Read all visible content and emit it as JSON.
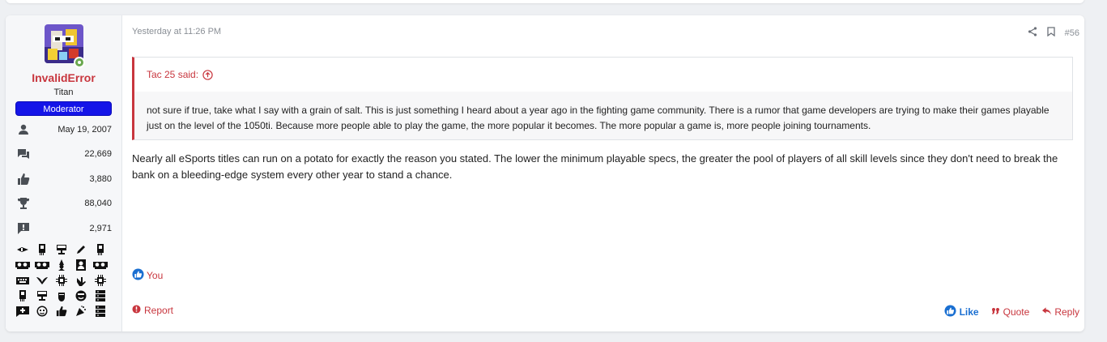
{
  "user": {
    "name": "InvalidError",
    "title": "Titan",
    "banner": "Moderator",
    "stats": [
      {
        "icon": "person-icon",
        "value": "May 19, 2007"
      },
      {
        "icon": "messages-icon",
        "value": "22,669"
      },
      {
        "icon": "thumbs-up-icon",
        "value": "3,880"
      },
      {
        "icon": "trophy-icon",
        "value": "88,040"
      },
      {
        "icon": "alert-message-icon",
        "value": "2,971"
      }
    ],
    "trophy_icons": [
      "sword-icon",
      "memory-card-icon",
      "monitor-icon",
      "pencil-icon",
      "memory-card-icon",
      "graphics-card-icon",
      "graphics-card-icon",
      "wizard-icon",
      "portrait-icon",
      "graphics-card-icon",
      "keyboard-icon",
      "wings-icon",
      "cpu-icon",
      "hand-icon",
      "cpu-icon",
      "memory-card-icon",
      "monitor-icon",
      "fist-icon",
      "smiley-icon",
      "server-icon",
      "comment-plus-icon",
      "smiley-icon",
      "thumbs-up-icon",
      "party-icon",
      "server-icon"
    ]
  },
  "post": {
    "date": "Yesterday at 11:26 PM",
    "number": "#56",
    "quote": {
      "author": "Tac 25 said:",
      "text": "not sure if true, take what I say with a grain of salt. This is just something I heard about a year ago in the fighting game community. There is a rumor that game developers are trying to make their games playable just on the level of the 1050ti. Because more people able to play the game, the more popular it becomes. The more popular a game is, more people joining tournaments."
    },
    "message": "Nearly all eSports titles can run on a potato for exactly the reason you stated. The lower the minimum playable specs, the greater the pool of players of all skill levels since they don't need to break the bank on a bleeding-edge system every other year to stand a chance.",
    "reactions": "You"
  },
  "footer": {
    "report": "Report",
    "like": "Like",
    "quote": "Quote",
    "reply": "Reply"
  },
  "colors": {
    "accent": "#c8363e",
    "moderator": "#1515e8",
    "like": "#1a6fd1"
  }
}
